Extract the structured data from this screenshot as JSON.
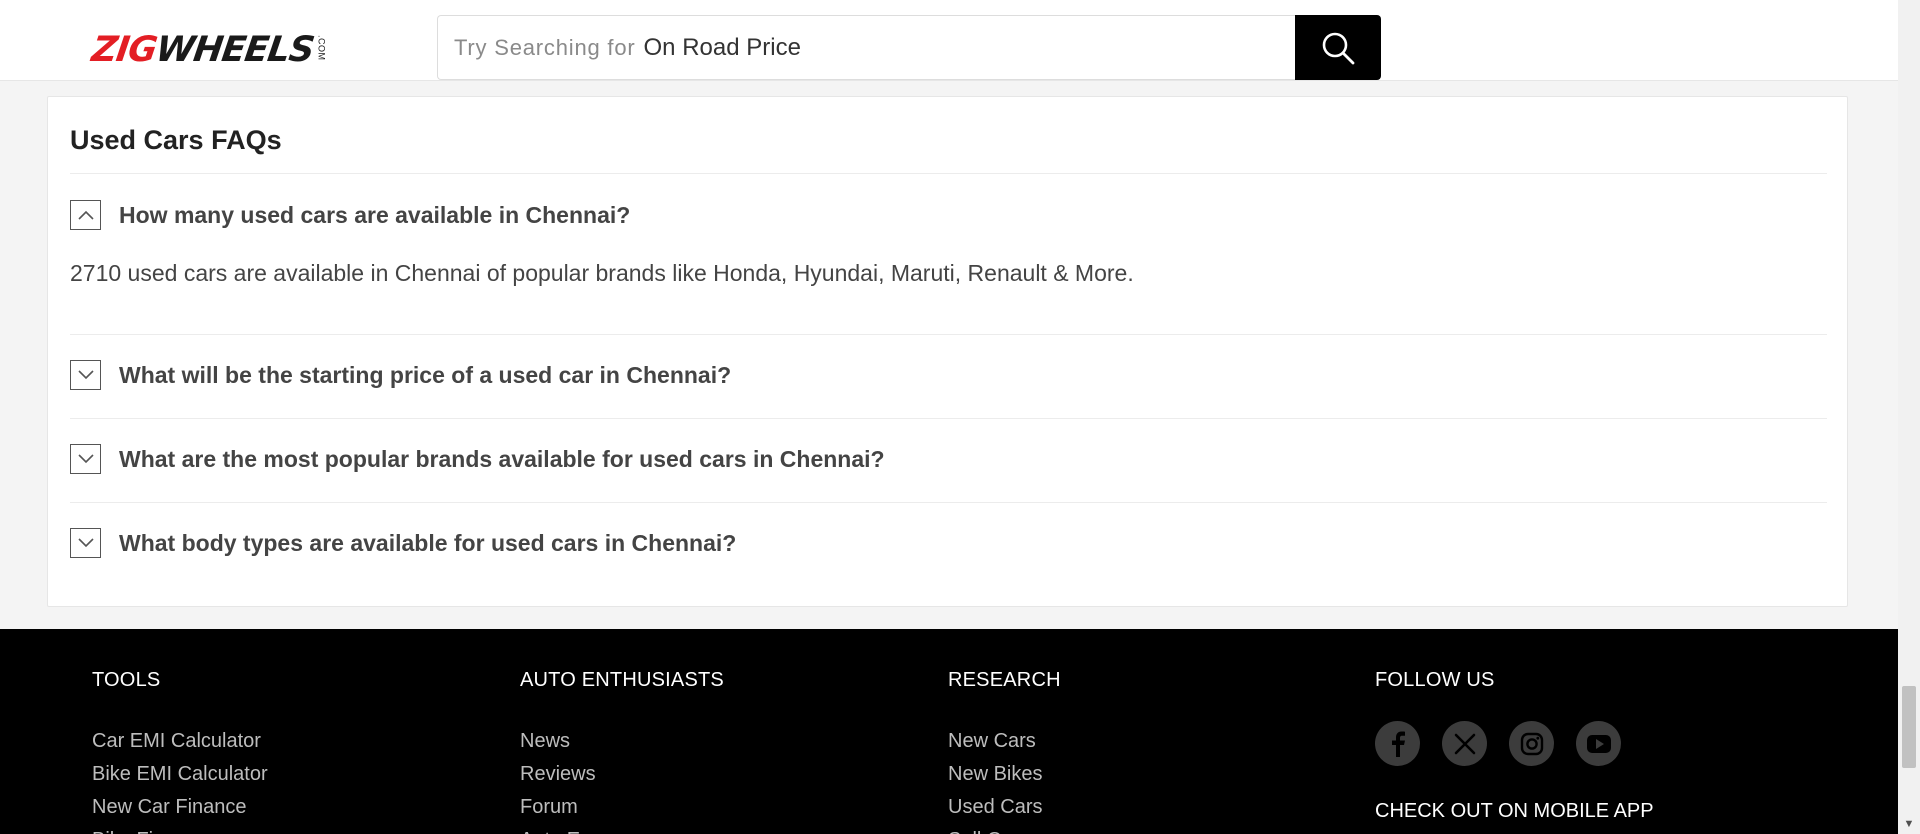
{
  "header": {
    "logo": {
      "part1": "ZIG",
      "part2": "WHEELS",
      "suffix": ".COM"
    },
    "search": {
      "placeholder": "Try Searching for",
      "value": "On Road Price"
    }
  },
  "faq": {
    "title": "Used Cars FAQs",
    "items": [
      {
        "question": "How many used cars are available in Chennai?",
        "expanded": true,
        "answer": "2710 used cars are available in Chennai of popular brands like Honda, Hyundai, Maruti, Renault & More."
      },
      {
        "question": "What will be the starting price of a used car in Chennai?",
        "expanded": false
      },
      {
        "question": "What are the most popular brands available for used cars in Chennai?",
        "expanded": false
      },
      {
        "question": "What body types are available for used cars in Chennai?",
        "expanded": false
      }
    ]
  },
  "footer": {
    "tools": {
      "heading": "TOOLS",
      "links": [
        "Car EMI Calculator",
        "Bike EMI Calculator",
        "New Car Finance",
        "Bike Finance"
      ]
    },
    "auto": {
      "heading": "AUTO ENTHUSIASTS",
      "links": [
        "News",
        "Reviews",
        "Forum",
        "Auto Expo"
      ]
    },
    "research": {
      "heading": "RESEARCH",
      "links": [
        "New Cars",
        "New Bikes",
        "Used Cars",
        "Sell Car"
      ]
    },
    "follow": {
      "heading": "FOLLOW US",
      "icons": [
        "facebook-icon",
        "x-icon",
        "instagram-icon",
        "youtube-icon"
      ],
      "app_heading": "CHECK OUT ON MOBILE APP"
    }
  },
  "colors": {
    "brand_red": "#e31e24",
    "footer_bg": "#000000",
    "search_button": "#000000"
  }
}
